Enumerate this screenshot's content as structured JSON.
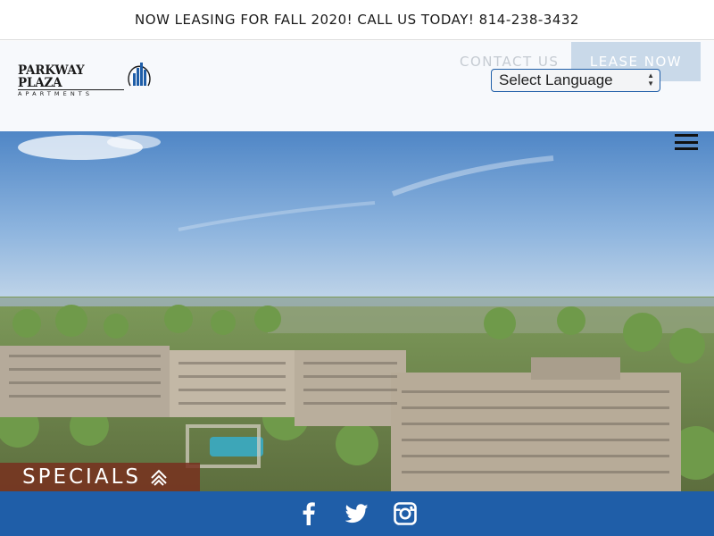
{
  "announcement": {
    "text": "NOW LEASING FOR FALL 2020! CALL US TODAY! 814-238-3432"
  },
  "logo": {
    "name": "PARKWAY PLAZA",
    "sub": "APARTMENTS",
    "icon": "building-icon"
  },
  "nav": {
    "contact_label": "CONTACT US",
    "lease_label": "LEASE NOW",
    "language_select": {
      "selected": "Select Language"
    },
    "menu_icon": "hamburger-menu-icon"
  },
  "hero": {
    "image_subject": "aerial view of apartment buildings"
  },
  "specials": {
    "label": "SPECIALS",
    "icon": "double-chevron-up-icon"
  },
  "social": [
    {
      "name": "facebook-icon"
    },
    {
      "name": "twitter-icon"
    },
    {
      "name": "instagram-icon"
    }
  ],
  "colors": {
    "brand_blue": "#1f5ea8",
    "specials_bg": "#78301e",
    "lease_button": "#c9d9e9",
    "contact_text": "#c5cbd2"
  }
}
